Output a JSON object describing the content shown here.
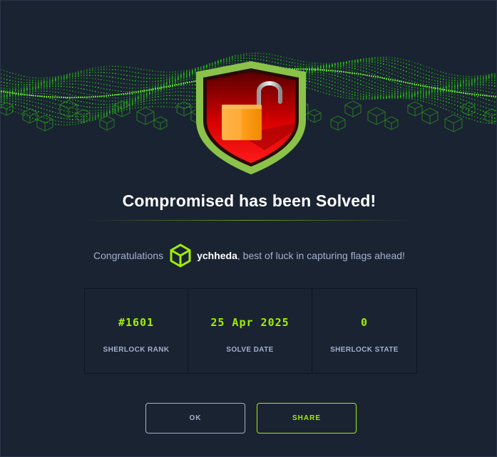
{
  "title": "Compromised has been Solved!",
  "congrats": {
    "prefix": "Congratulations",
    "username": "ychheda",
    "suffix": ", best of luck in capturing flags ahead!"
  },
  "stats": [
    {
      "value": "#1601",
      "label": "SHERLOCK RANK"
    },
    {
      "value": "25 Apr 2025",
      "label": "SOLVE DATE"
    },
    {
      "value": "0",
      "label": "SHERLOCK STATE"
    }
  ],
  "buttons": {
    "ok": "OK",
    "share": "SHARE"
  },
  "icons": {
    "badge": "unlocked-padlock-shield-icon",
    "user": "cube-icon"
  },
  "colors": {
    "accent": "#9fef00",
    "background": "#1a2332",
    "text_muted": "#a4b1cd"
  }
}
